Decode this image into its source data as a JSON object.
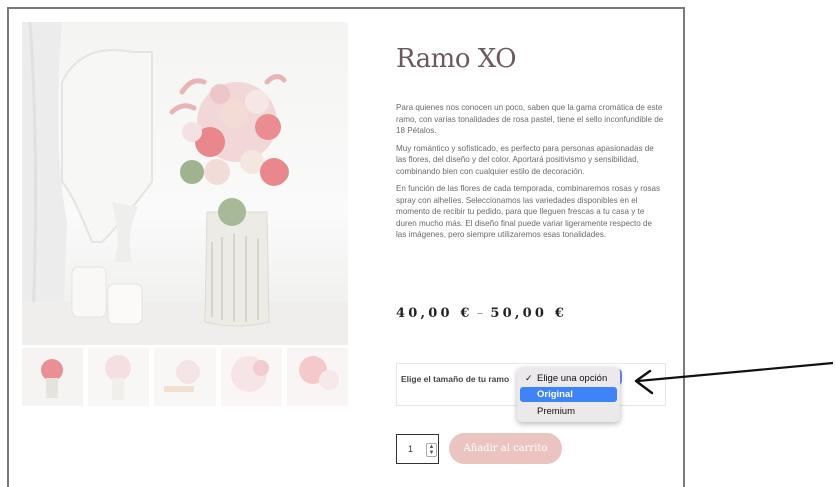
{
  "product": {
    "title": "Ramo XO",
    "description": [
      "Para quienes nos conocen un poco, saben que la gama cromática de este ramo, con varias tonalidades de rosa pastel, tiene el sello inconfundible de 18 Pétalos.",
      "Muy romántico y sofisticado, es perfecto para personas apasionadas de las flores, del diseño y del color. Aportará positivismo y sensibilidad, combinando bien con cualquier estilo de decoración.",
      "En función de las flores de cada temporada, combinaremos rosas y rosas spray con alhelíes. Seleccionamos las variedades disponibles en el momento de recibir tu pedido, para que lleguen  frescas a tu casa y te duren mucho más. El diseño final puede variar ligeramente respecto de las imágenes, pero siempre utilizaremos esas tonalidades."
    ],
    "price_min": "40,00 €",
    "price_sep": "–",
    "price_max": "50,00 €"
  },
  "variation": {
    "label": "Elige el tamaño de tu ramo",
    "options": [
      {
        "label": "Elige una opción",
        "checked": true
      },
      {
        "label": "Original",
        "highlighted": true
      },
      {
        "label": "Premium"
      }
    ],
    "check_mark": "✓"
  },
  "cart": {
    "quantity": "1",
    "add_button": "Añadir al carrito"
  },
  "colors": {
    "accent_pink": "#ebc3c0",
    "title_color": "#6a5a5e",
    "select_highlight": "#3e84f6"
  },
  "icons": {
    "annotation": "arrow-left-icon",
    "spinner": "updown-spinner-icon"
  }
}
